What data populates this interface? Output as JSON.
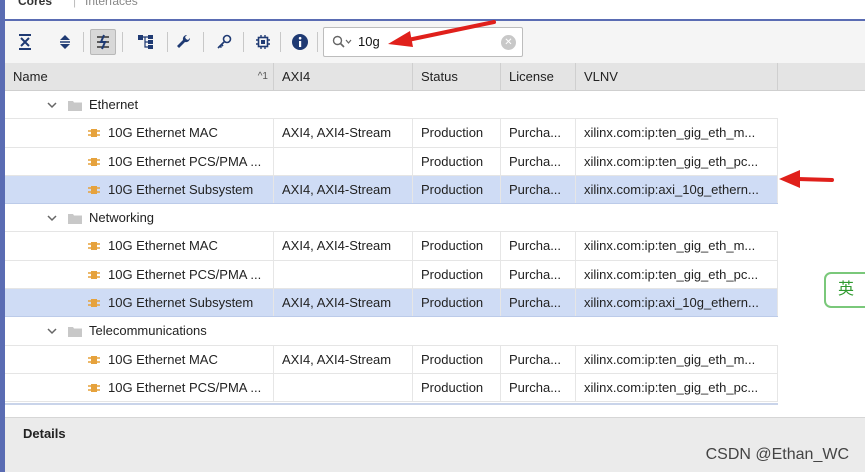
{
  "tabs": {
    "active": "Cores",
    "separator": "|",
    "inactive": "Interfaces"
  },
  "toolbar": {
    "buttons": [
      "collapse-all",
      "expand-all",
      "filter-toggle",
      "hierarchy",
      "customize",
      "key",
      "chip",
      "info"
    ],
    "search": {
      "value": "10g"
    }
  },
  "table": {
    "columns": {
      "name": "Name",
      "axi4": "AXI4",
      "status": "Status",
      "license": "License",
      "vlnv": "VLNV"
    },
    "sort_indicator": "^1",
    "groups": [
      {
        "name": "Ethernet",
        "rows": [
          {
            "name": "10G Ethernet MAC",
            "axi4": "AXI4, AXI4-Stream",
            "status": "Production",
            "license": "Purcha...",
            "vlnv": "xilinx.com:ip:ten_gig_eth_m..."
          },
          {
            "name": "10G Ethernet PCS/PMA ...",
            "axi4": "",
            "status": "Production",
            "license": "Purcha...",
            "vlnv": "xilinx.com:ip:ten_gig_eth_pc..."
          },
          {
            "name": "10G Ethernet Subsystem",
            "axi4": "AXI4, AXI4-Stream",
            "status": "Production",
            "license": "Purcha...",
            "vlnv": "xilinx.com:ip:axi_10g_ethern...",
            "selected": true
          }
        ]
      },
      {
        "name": "Networking",
        "rows": [
          {
            "name": "10G Ethernet MAC",
            "axi4": "AXI4, AXI4-Stream",
            "status": "Production",
            "license": "Purcha...",
            "vlnv": "xilinx.com:ip:ten_gig_eth_m..."
          },
          {
            "name": "10G Ethernet PCS/PMA ...",
            "axi4": "",
            "status": "Production",
            "license": "Purcha...",
            "vlnv": "xilinx.com:ip:ten_gig_eth_pc..."
          },
          {
            "name": "10G Ethernet Subsystem",
            "axi4": "AXI4, AXI4-Stream",
            "status": "Production",
            "license": "Purcha...",
            "vlnv": "xilinx.com:ip:axi_10g_ethern...",
            "selected": true
          }
        ]
      },
      {
        "name": "Telecommunications",
        "rows": [
          {
            "name": "10G Ethernet MAC",
            "axi4": "AXI4, AXI4-Stream",
            "status": "Production",
            "license": "Purcha...",
            "vlnv": "xilinx.com:ip:ten_gig_eth_m..."
          },
          {
            "name": "10G Ethernet PCS/PMA ...",
            "axi4": "",
            "status": "Production",
            "license": "Purcha...",
            "vlnv": "xilinx.com:ip:ten_gig_eth_pc..."
          }
        ]
      }
    ]
  },
  "details": {
    "title": "Details"
  },
  "ime_badge": "英",
  "watermark": "CSDN @Ethan_WC",
  "colors": {
    "annotation_arrow": "#e0201b",
    "selection": "#cfdcf5",
    "frame": "#5a6cb3",
    "chip_icon": "#e6a23c"
  }
}
